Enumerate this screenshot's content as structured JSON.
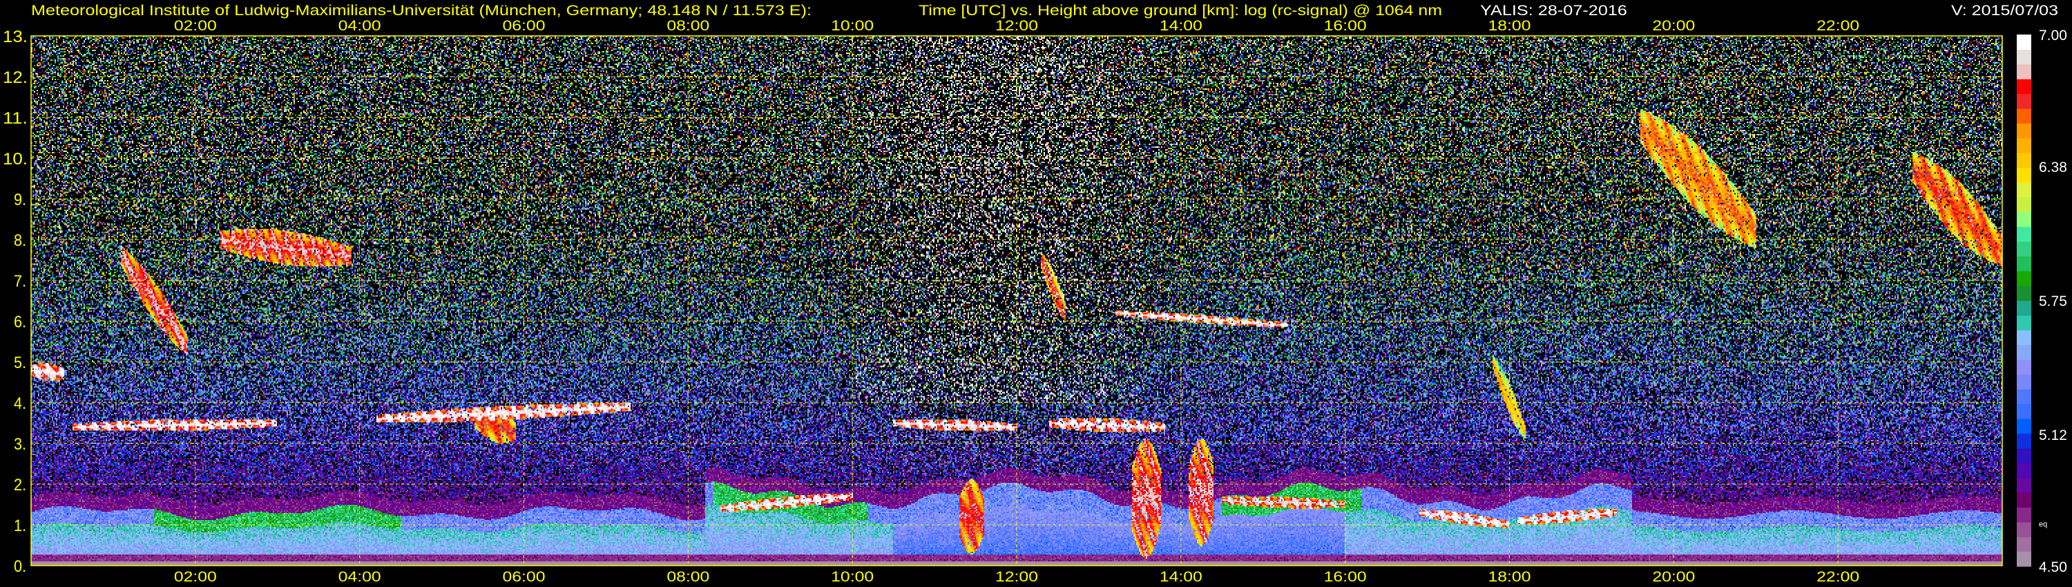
{
  "header": {
    "institute": "Meteorological Institute of Ludwig-Maximilians-Universität (München, Germany; 48.148 N / 11.573 E):",
    "description": "Time [UTC] vs. Height above ground [km]: log (rc-signal) @ 1064 nm",
    "station_date": "YALIS: 28-07-2016",
    "version": "V: 2015/07/03",
    "title_color": "#ffff00",
    "info_color": "#ffffff"
  },
  "chart_data": {
    "type": "heatmap",
    "title": "Time [UTC] vs. Height above ground [km]: log (rc-signal) @ 1064 nm",
    "xlabel": "Time [UTC]",
    "ylabel": "Height above ground [km]",
    "xlim": [
      0,
      24
    ],
    "ylim": [
      0,
      13
    ],
    "grid": true,
    "x_ticks": [
      {
        "value": 2,
        "label": "02:00"
      },
      {
        "value": 4,
        "label": "04:00"
      },
      {
        "value": 6,
        "label": "06:00"
      },
      {
        "value": 8,
        "label": "08:00"
      },
      {
        "value": 10,
        "label": "10:00"
      },
      {
        "value": 12,
        "label": "12:00"
      },
      {
        "value": 14,
        "label": "14:00"
      },
      {
        "value": 16,
        "label": "16:00"
      },
      {
        "value": 18,
        "label": "18:00"
      },
      {
        "value": 20,
        "label": "20:00"
      },
      {
        "value": 22,
        "label": "22:00"
      }
    ],
    "y_ticks": [
      {
        "value": 0,
        "label": "0."
      },
      {
        "value": 1,
        "label": "1."
      },
      {
        "value": 2,
        "label": "2."
      },
      {
        "value": 3,
        "label": "3."
      },
      {
        "value": 4,
        "label": "4."
      },
      {
        "value": 5,
        "label": "5."
      },
      {
        "value": 6,
        "label": "6."
      },
      {
        "value": 7,
        "label": "7."
      },
      {
        "value": 8,
        "label": "8."
      },
      {
        "value": 9,
        "label": "9."
      },
      {
        "value": 10,
        "label": "10."
      },
      {
        "value": 11,
        "label": "11."
      },
      {
        "value": 12,
        "label": "12."
      },
      {
        "value": 13,
        "label": "13."
      }
    ],
    "colorbar": {
      "range": [
        4.5,
        7.0
      ],
      "labels": [
        {
          "value": 7.0,
          "label": "7.00"
        },
        {
          "value": 6.38,
          "label": "6.38"
        },
        {
          "value": 5.75,
          "label": "5.75"
        },
        {
          "value": 5.12,
          "label": "5.12"
        },
        {
          "value": 4.7,
          "label": "eq"
        },
        {
          "value": 4.5,
          "label": "4.50"
        }
      ],
      "colors_low_to_high": [
        "#a890a8",
        "#a070a0",
        "#985098",
        "#882888",
        "#700070",
        "#6808a0",
        "#5008b0",
        "#3010c0",
        "#1030e0",
        "#0060ff",
        "#3870ff",
        "#5078ff",
        "#7888f8",
        "#9090f8",
        "#88a8f8",
        "#88c0ff",
        "#30c8b0",
        "#20a890",
        "#189030",
        "#18a800",
        "#20c058",
        "#30d080",
        "#40e8a0",
        "#90ff80",
        "#c8f040",
        "#e0f040",
        "#ffe000",
        "#ffc800",
        "#ffb000",
        "#ff9800",
        "#ff6000",
        "#f02828",
        "#ff0000",
        "#ecc0c0",
        "#e8e0e0",
        "#ffffff"
      ]
    },
    "features": [
      {
        "kind": "cloud",
        "t0": 0.0,
        "t1": 0.4,
        "h0": 4.8,
        "h1": 4.7,
        "thickness": 0.2,
        "level": 35
      },
      {
        "kind": "cloud",
        "t0": 0.5,
        "t1": 3.0,
        "h0": 3.4,
        "h1": 3.5,
        "thickness": 0.12,
        "level": 35
      },
      {
        "kind": "cloud",
        "t0": 1.1,
        "t1": 1.9,
        "h0": 7.6,
        "h1": 5.4,
        "thickness": 0.45,
        "level": 33
      },
      {
        "kind": "cloud",
        "t0": 2.3,
        "t1": 3.9,
        "h0": 8.0,
        "h1": 7.6,
        "thickness": 0.4,
        "level": 33
      },
      {
        "kind": "cloud",
        "t0": 4.2,
        "t1": 7.3,
        "h0": 3.6,
        "h1": 3.9,
        "thickness": 0.15,
        "level": 35
      },
      {
        "kind": "cloud",
        "t0": 5.4,
        "t1": 5.9,
        "h0": 3.6,
        "h1": 3.3,
        "thickness": 0.4,
        "level": 31
      },
      {
        "kind": "cloud",
        "t0": 8.4,
        "t1": 10.0,
        "h0": 1.4,
        "h1": 1.7,
        "thickness": 0.12,
        "level": 35
      },
      {
        "kind": "cloud",
        "t0": 10.5,
        "t1": 12.0,
        "h0": 3.5,
        "h1": 3.4,
        "thickness": 0.12,
        "level": 35
      },
      {
        "kind": "cloud",
        "t0": 12.4,
        "t1": 13.8,
        "h0": 3.5,
        "h1": 3.4,
        "thickness": 0.15,
        "level": 35
      },
      {
        "kind": "precip",
        "t0": 11.3,
        "t1": 11.6,
        "h0": 2.0,
        "h1": 0.4,
        "thickness": 1.6,
        "level": 32
      },
      {
        "kind": "precip",
        "t0": 13.4,
        "t1": 13.75,
        "h0": 3.0,
        "h1": 0.3,
        "thickness": 2.6,
        "level": 33
      },
      {
        "kind": "precip",
        "t0": 14.1,
        "t1": 14.4,
        "h0": 3.0,
        "h1": 0.6,
        "thickness": 2.2,
        "level": 33
      },
      {
        "kind": "cloud",
        "t0": 12.3,
        "t1": 12.6,
        "h0": 7.5,
        "h1": 6.2,
        "thickness": 0.35,
        "level": 31
      },
      {
        "kind": "cloud",
        "t0": 13.2,
        "t1": 15.3,
        "h0": 6.2,
        "h1": 5.9,
        "thickness": 0.08,
        "level": 35
      },
      {
        "kind": "cloud",
        "t0": 14.5,
        "t1": 16.0,
        "h0": 1.6,
        "h1": 1.5,
        "thickness": 0.12,
        "level": 34
      },
      {
        "kind": "cloud",
        "t0": 16.9,
        "t1": 18.0,
        "h0": 1.3,
        "h1": 1.0,
        "thickness": 0.12,
        "level": 35
      },
      {
        "kind": "cloud",
        "t0": 18.1,
        "t1": 19.3,
        "h0": 1.1,
        "h1": 1.3,
        "thickness": 0.12,
        "level": 35
      },
      {
        "kind": "cloud",
        "t0": 17.8,
        "t1": 18.2,
        "h0": 5.0,
        "h1": 3.2,
        "thickness": 0.35,
        "level": 28
      },
      {
        "kind": "cloud",
        "t0": 19.6,
        "t1": 21.0,
        "h0": 10.8,
        "h1": 8.2,
        "thickness": 0.8,
        "level": 30
      },
      {
        "kind": "cloud",
        "t0": 22.9,
        "t1": 24.0,
        "h0": 9.8,
        "h1": 7.7,
        "thickness": 0.7,
        "level": 31
      }
    ]
  }
}
